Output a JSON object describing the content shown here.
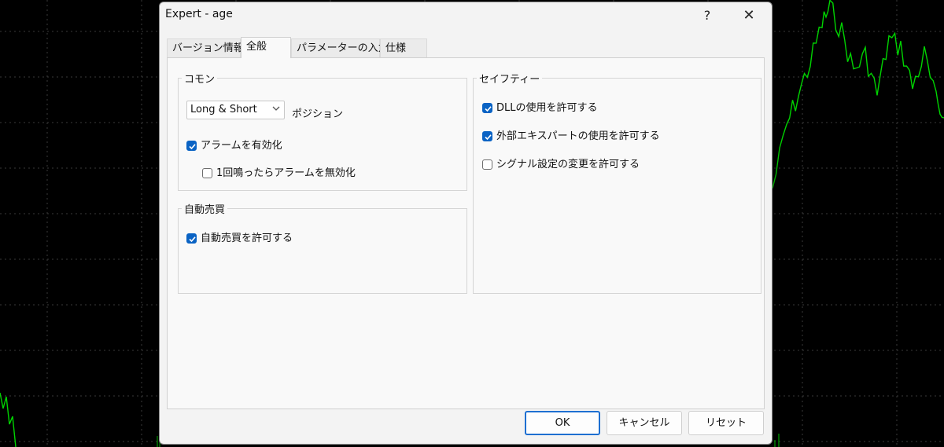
{
  "window": {
    "title": "Expert - age",
    "help_label": "?",
    "close_label": "✕"
  },
  "tabs": [
    {
      "label": "バージョン情報",
      "active": false
    },
    {
      "label": "全般",
      "active": true
    },
    {
      "label": "パラメーターの入力",
      "active": false
    },
    {
      "label": "仕様",
      "active": false
    }
  ],
  "common": {
    "title": "コモン",
    "position_select": {
      "value": "Long & Short",
      "label": "ポジション"
    },
    "alarm_enable": {
      "label": "アラームを有効化",
      "checked": true
    },
    "alarm_disable_after_one": {
      "label": "1回鳴ったらアラームを無効化",
      "checked": false
    }
  },
  "auto_trade": {
    "title": "自動売買",
    "allow": {
      "label": "自動売買を許可する",
      "checked": true
    }
  },
  "safety": {
    "title": "セイフティー",
    "allow_dll": {
      "label": "DLLの使用を許可する",
      "checked": true
    },
    "allow_external_experts": {
      "label": "外部エキスパートの使用を許可する",
      "checked": true
    },
    "allow_signal_change": {
      "label": "シグナル設定の変更を許可する",
      "checked": false
    }
  },
  "buttons": {
    "ok": "OK",
    "cancel": "キャンセル",
    "reset": "リセット"
  },
  "colors": {
    "chart_line": "#00d400",
    "chart_grid": "#3a3a3a",
    "accent": "#0a63c4",
    "background": "#000000"
  },
  "icons": {
    "dropdown": "chevron-down-icon",
    "checkmark": "check-icon"
  }
}
